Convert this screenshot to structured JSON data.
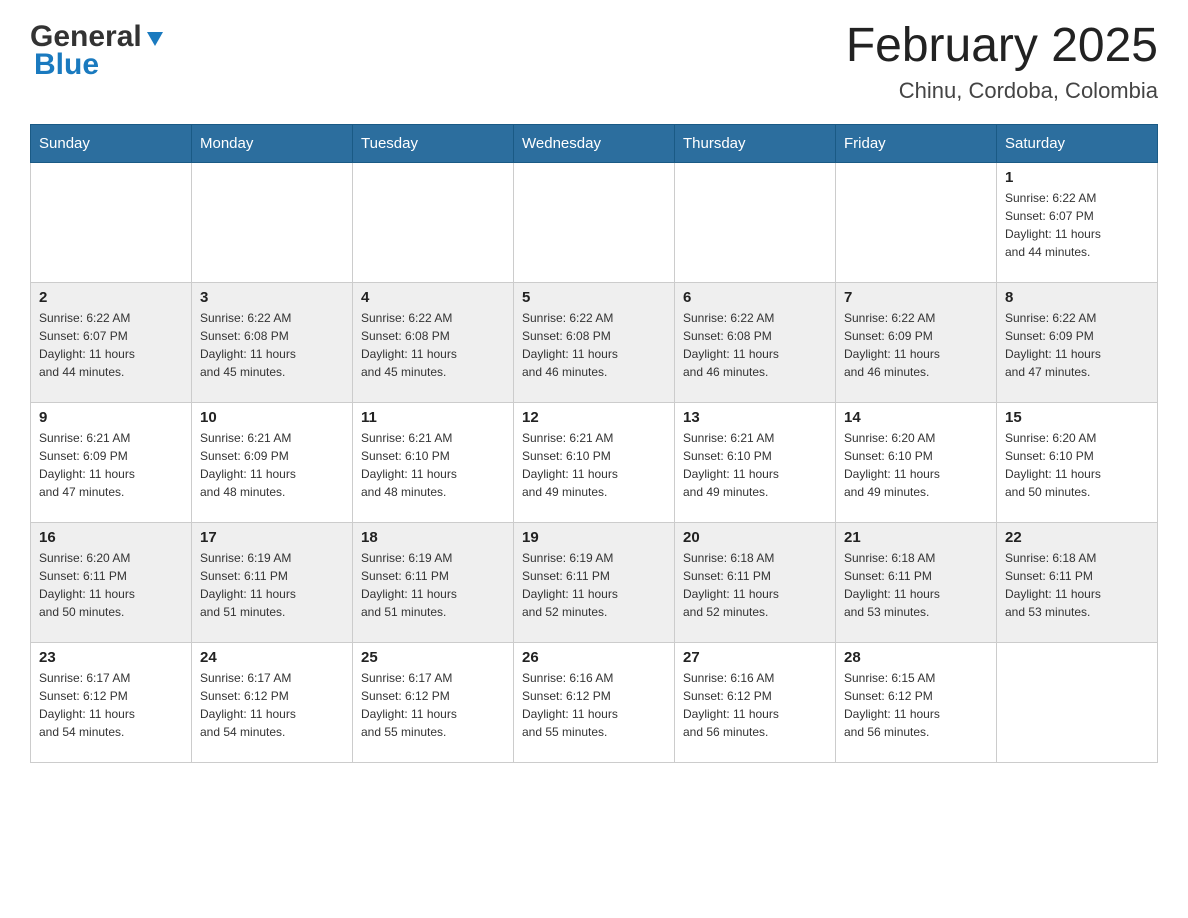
{
  "header": {
    "logo_line1": "General",
    "logo_line2": "Blue",
    "month": "February 2025",
    "location": "Chinu, Cordoba, Colombia"
  },
  "weekdays": [
    "Sunday",
    "Monday",
    "Tuesday",
    "Wednesday",
    "Thursday",
    "Friday",
    "Saturday"
  ],
  "weeks": [
    [
      {
        "day": "",
        "info": ""
      },
      {
        "day": "",
        "info": ""
      },
      {
        "day": "",
        "info": ""
      },
      {
        "day": "",
        "info": ""
      },
      {
        "day": "",
        "info": ""
      },
      {
        "day": "",
        "info": ""
      },
      {
        "day": "1",
        "info": "Sunrise: 6:22 AM\nSunset: 6:07 PM\nDaylight: 11 hours\nand 44 minutes."
      }
    ],
    [
      {
        "day": "2",
        "info": "Sunrise: 6:22 AM\nSunset: 6:07 PM\nDaylight: 11 hours\nand 44 minutes."
      },
      {
        "day": "3",
        "info": "Sunrise: 6:22 AM\nSunset: 6:08 PM\nDaylight: 11 hours\nand 45 minutes."
      },
      {
        "day": "4",
        "info": "Sunrise: 6:22 AM\nSunset: 6:08 PM\nDaylight: 11 hours\nand 45 minutes."
      },
      {
        "day": "5",
        "info": "Sunrise: 6:22 AM\nSunset: 6:08 PM\nDaylight: 11 hours\nand 46 minutes."
      },
      {
        "day": "6",
        "info": "Sunrise: 6:22 AM\nSunset: 6:08 PM\nDaylight: 11 hours\nand 46 minutes."
      },
      {
        "day": "7",
        "info": "Sunrise: 6:22 AM\nSunset: 6:09 PM\nDaylight: 11 hours\nand 46 minutes."
      },
      {
        "day": "8",
        "info": "Sunrise: 6:22 AM\nSunset: 6:09 PM\nDaylight: 11 hours\nand 47 minutes."
      }
    ],
    [
      {
        "day": "9",
        "info": "Sunrise: 6:21 AM\nSunset: 6:09 PM\nDaylight: 11 hours\nand 47 minutes."
      },
      {
        "day": "10",
        "info": "Sunrise: 6:21 AM\nSunset: 6:09 PM\nDaylight: 11 hours\nand 48 minutes."
      },
      {
        "day": "11",
        "info": "Sunrise: 6:21 AM\nSunset: 6:10 PM\nDaylight: 11 hours\nand 48 minutes."
      },
      {
        "day": "12",
        "info": "Sunrise: 6:21 AM\nSunset: 6:10 PM\nDaylight: 11 hours\nand 49 minutes."
      },
      {
        "day": "13",
        "info": "Sunrise: 6:21 AM\nSunset: 6:10 PM\nDaylight: 11 hours\nand 49 minutes."
      },
      {
        "day": "14",
        "info": "Sunrise: 6:20 AM\nSunset: 6:10 PM\nDaylight: 11 hours\nand 49 minutes."
      },
      {
        "day": "15",
        "info": "Sunrise: 6:20 AM\nSunset: 6:10 PM\nDaylight: 11 hours\nand 50 minutes."
      }
    ],
    [
      {
        "day": "16",
        "info": "Sunrise: 6:20 AM\nSunset: 6:11 PM\nDaylight: 11 hours\nand 50 minutes."
      },
      {
        "day": "17",
        "info": "Sunrise: 6:19 AM\nSunset: 6:11 PM\nDaylight: 11 hours\nand 51 minutes."
      },
      {
        "day": "18",
        "info": "Sunrise: 6:19 AM\nSunset: 6:11 PM\nDaylight: 11 hours\nand 51 minutes."
      },
      {
        "day": "19",
        "info": "Sunrise: 6:19 AM\nSunset: 6:11 PM\nDaylight: 11 hours\nand 52 minutes."
      },
      {
        "day": "20",
        "info": "Sunrise: 6:18 AM\nSunset: 6:11 PM\nDaylight: 11 hours\nand 52 minutes."
      },
      {
        "day": "21",
        "info": "Sunrise: 6:18 AM\nSunset: 6:11 PM\nDaylight: 11 hours\nand 53 minutes."
      },
      {
        "day": "22",
        "info": "Sunrise: 6:18 AM\nSunset: 6:11 PM\nDaylight: 11 hours\nand 53 minutes."
      }
    ],
    [
      {
        "day": "23",
        "info": "Sunrise: 6:17 AM\nSunset: 6:12 PM\nDaylight: 11 hours\nand 54 minutes."
      },
      {
        "day": "24",
        "info": "Sunrise: 6:17 AM\nSunset: 6:12 PM\nDaylight: 11 hours\nand 54 minutes."
      },
      {
        "day": "25",
        "info": "Sunrise: 6:17 AM\nSunset: 6:12 PM\nDaylight: 11 hours\nand 55 minutes."
      },
      {
        "day": "26",
        "info": "Sunrise: 6:16 AM\nSunset: 6:12 PM\nDaylight: 11 hours\nand 55 minutes."
      },
      {
        "day": "27",
        "info": "Sunrise: 6:16 AM\nSunset: 6:12 PM\nDaylight: 11 hours\nand 56 minutes."
      },
      {
        "day": "28",
        "info": "Sunrise: 6:15 AM\nSunset: 6:12 PM\nDaylight: 11 hours\nand 56 minutes."
      },
      {
        "day": "",
        "info": ""
      }
    ]
  ]
}
